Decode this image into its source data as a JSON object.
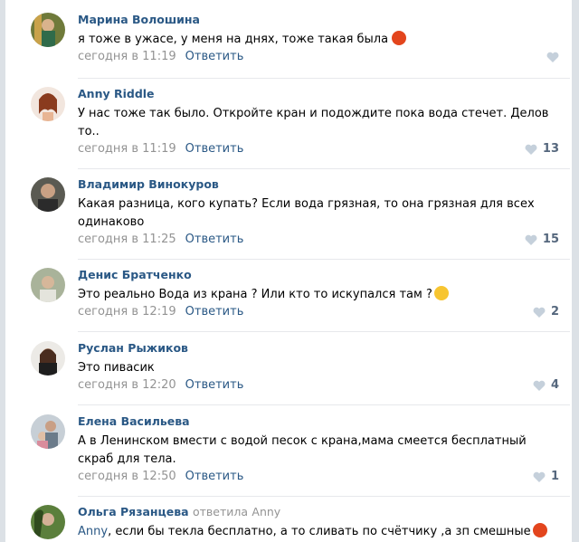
{
  "comments": [
    {
      "author": "Марина Волошина",
      "text": "я тоже в ужасе, у меня на днях, тоже такая была",
      "time": "сегодня в 11:19",
      "reply": "Ответить",
      "likes": "",
      "emoji": "angry-emoji"
    },
    {
      "author": "Anny Riddle",
      "text": "У нас тоже так было. Откройте кран и подождите пока вода стечет. Делов то..",
      "time": "сегодня в 11:19",
      "reply": "Ответить",
      "likes": "13"
    },
    {
      "author": "Владимир Винокуров",
      "text": "Какая разница, кого купать? Если вода грязная, то она грязная для всех одинаково",
      "time": "сегодня в 11:25",
      "reply": "Ответить",
      "likes": "15"
    },
    {
      "author": "Денис Братченко",
      "text": "Это реально Вода из крана ? Или кто то искупался там ?",
      "time": "сегодня в 12:19",
      "reply": "Ответить",
      "likes": "2",
      "emoji": "laughing-emoji"
    },
    {
      "author": "Руслан Рыжиков",
      "text": "Это пивасик",
      "time": "сегодня в 12:20",
      "reply": "Ответить",
      "likes": "4"
    },
    {
      "author": "Елена Васильева",
      "text": "А в Ленинском вмести с водой песок с крана,мама смеется бесплатный скраб для тела.",
      "time": "сегодня в 12:50",
      "reply": "Ответить",
      "likes": "1"
    },
    {
      "author": "Ольга Рязанцева",
      "reply_to_word": "ответила",
      "reply_to_name": "Anny",
      "mention": "Anny",
      "text": ", если бы текла бесплатно, а то сливать по счётчику ,а зп смешные",
      "emoji": "angry-emoji"
    }
  ],
  "colors": {
    "link": "#2a5885",
    "meta": "#939393",
    "separator": "#e7e8ec"
  }
}
